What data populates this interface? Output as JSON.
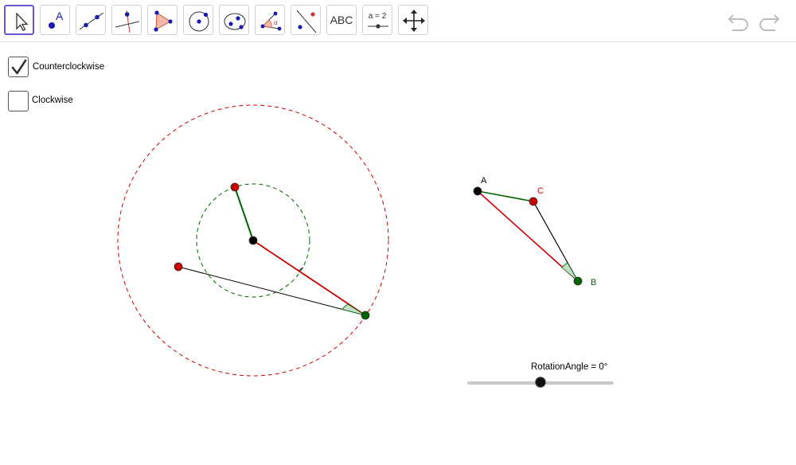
{
  "toolbar": {
    "tools": [
      {
        "name": "move-tool",
        "icon": "arrow-pointer-icon"
      },
      {
        "name": "point-tool",
        "icon": "point-a-icon",
        "glyph": "A"
      },
      {
        "name": "line-tool",
        "icon": "line-through-points-icon"
      },
      {
        "name": "perpendicular-tool",
        "icon": "perpendicular-line-icon"
      },
      {
        "name": "polygon-tool",
        "icon": "polygon-icon"
      },
      {
        "name": "circle-tool",
        "icon": "circle-center-point-icon"
      },
      {
        "name": "conic-tool",
        "icon": "ellipse-icon"
      },
      {
        "name": "angle-tool",
        "icon": "angle-icon",
        "glyph": "α"
      },
      {
        "name": "reflect-tool",
        "icon": "reflect-about-line-icon"
      },
      {
        "name": "text-tool",
        "icon": "text-icon",
        "label": "ABC"
      },
      {
        "name": "slider-tool",
        "icon": "slider-icon",
        "label": "a = 2"
      },
      {
        "name": "move-graphics-tool",
        "icon": "move-graphics-icon"
      }
    ],
    "undo_icon": "undo-icon",
    "redo_icon": "redo-icon"
  },
  "checkboxes": [
    {
      "label": "Counterclockwise",
      "checked": true
    },
    {
      "label": "Clockwise",
      "checked": false
    }
  ],
  "points": {
    "A": {
      "label": "A",
      "color": "#000000"
    },
    "B": {
      "label": "B",
      "color": "#006400"
    },
    "C": {
      "label": "C",
      "color": "#cc0000"
    }
  },
  "slider": {
    "label": "RotationAngle = 0°",
    "value_fraction": 0.5
  },
  "colors": {
    "accent": "#6557d2",
    "red": "#cc0000",
    "green": "#006400",
    "black": "#000000"
  }
}
